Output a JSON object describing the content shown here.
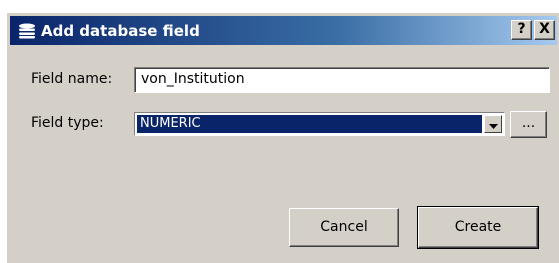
{
  "window": {
    "title": "Add database field",
    "help_button": "?",
    "close_button": "X",
    "icon": "database-icon"
  },
  "form": {
    "field_name_label": "Field name:",
    "field_name_value": "von_Institution",
    "field_type_label": "Field type:",
    "field_type_value": "NUMERIC",
    "browse_label": "..."
  },
  "buttons": {
    "cancel_label": "Cancel",
    "create_label": "Create"
  },
  "colors": {
    "titlebar_start": "#0a246a",
    "titlebar_end": "#a6caf0",
    "dialog_face": "#d4d0c8",
    "selection": "#0a246a"
  }
}
